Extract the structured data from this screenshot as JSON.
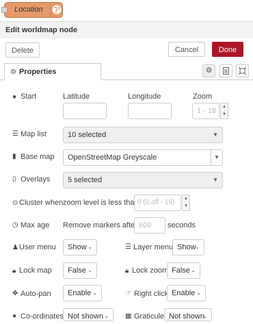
{
  "node": {
    "label": "Location",
    "icon": "globe-icon",
    "color": "#e69a6a"
  },
  "tray": {
    "title": "Edit worldmap node"
  },
  "toolbar": {
    "delete_label": "Delete",
    "cancel_label": "Cancel",
    "done_label": "Done",
    "done_color": "#ad1625"
  },
  "tabs": {
    "properties_label": "Properties",
    "icons": [
      "gear-icon",
      "description-icon",
      "appearance-icon"
    ]
  },
  "start": {
    "label": "Start",
    "latitude_label": "Latitude",
    "longitude_label": "Longitude",
    "zoom_label": "Zoom",
    "zoom_placeholder": "1 - 18"
  },
  "map_list": {
    "label": "Map list",
    "value": "10 selected"
  },
  "base_map": {
    "label": "Base map",
    "value": "OpenStreetMap Greyscale"
  },
  "overlays": {
    "label": "Overlays",
    "value": "5 selected"
  },
  "cluster": {
    "label": "Cluster when",
    "text": "zoom level is less than",
    "placeholder": "0 (0,off - 19)"
  },
  "max_age": {
    "label": "Max age",
    "text": "Remove markers after",
    "placeholder": "600",
    "unit": "seconds"
  },
  "user_menu": {
    "label": "User menu",
    "value": "Show"
  },
  "layer_menu": {
    "label": "Layer menu",
    "value": "Show"
  },
  "lock_map": {
    "label": "Lock map",
    "value": "False"
  },
  "lock_zoom": {
    "label": "Lock zoom",
    "value": "False"
  },
  "auto_pan": {
    "label": "Auto-pan",
    "value": "Enable"
  },
  "right_click": {
    "label": "Right click",
    "value": "Enable"
  },
  "coordinates": {
    "label": "Co-ordinates",
    "value": "Not shown"
  },
  "graticule": {
    "label": "Graticule",
    "value": "Not shown"
  }
}
